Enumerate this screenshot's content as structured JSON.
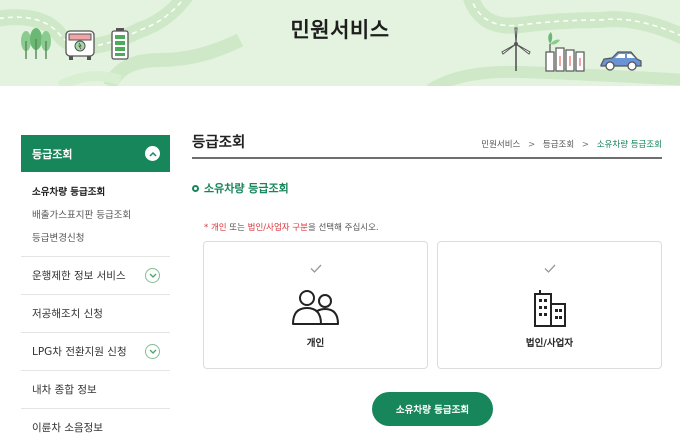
{
  "banner": {
    "title": "민원서비스"
  },
  "sidebar": {
    "header": "등급조회",
    "sub_items": [
      {
        "label": "소유차량 등급조회",
        "active": true
      },
      {
        "label": "배출가스표지판 등급조회"
      },
      {
        "label": "등급변경신청"
      }
    ],
    "items": [
      {
        "label": "운행제한 정보 서비스",
        "expandable": true
      },
      {
        "label": "저공해조치 신청",
        "expandable": false
      },
      {
        "label": "LPG차 전환지원 신청",
        "expandable": true
      },
      {
        "label": "내차 종합 정보",
        "expandable": false
      },
      {
        "label": "이륜차 소음정보",
        "expandable": false
      }
    ]
  },
  "main": {
    "title": "등급조회",
    "breadcrumb": [
      "민원서비스",
      "등급조회",
      "소유차량 등급조회"
    ],
    "breadcrumb_sep": ">",
    "section_title": "소유차량 등급조회",
    "notice": {
      "star": "*",
      "opt1": "개인",
      "mid": " 또는 ",
      "opt2": "법인/사업자 구분",
      "rest": "을 선택해 주십시오."
    },
    "cards": [
      {
        "label": "개인",
        "icon": "people-icon"
      },
      {
        "label": "법인/사업자",
        "icon": "building-icon"
      }
    ],
    "submit_label": "소유차량 등급조회"
  },
  "colors": {
    "accent": "#17865a",
    "banner_bg": "#e3f3df",
    "notice_red": "#d9373c"
  }
}
